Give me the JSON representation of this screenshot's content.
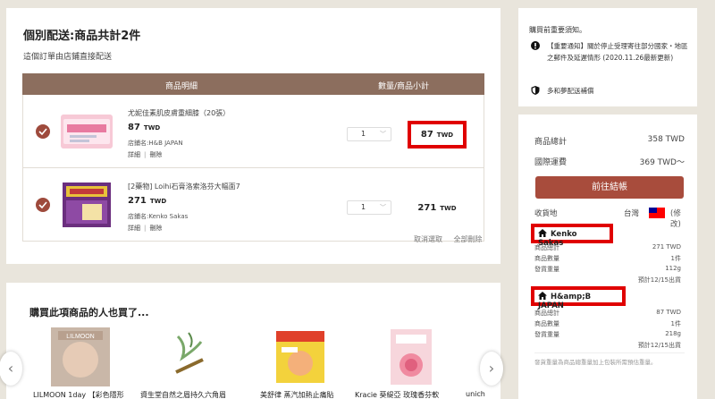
{
  "cart": {
    "title": "個別配送:商品共計2件",
    "subtitle": "這個訂單由店鋪直接配送",
    "header_item": "商品明細",
    "header_qty": "數量/商品小計",
    "items": [
      {
        "name": "尤妮佳素肌皮膚重細膝（20張）",
        "price": "87",
        "currency": "TWD",
        "store": "店鋪名:H&B JAPAN",
        "detail_link": "詳細",
        "delete_link": "刪除",
        "qty": "1",
        "subtotal": "87",
        "subtotal_currency": "TWD"
      },
      {
        "name": "[2藥物] Loihi石膏洛索洛芬大幅面7",
        "price": "271",
        "currency": "TWD",
        "store": "店鋪名:Kenko Sakas",
        "detail_link": "詳細",
        "delete_link": "刪除",
        "qty": "1",
        "subtotal": "271",
        "subtotal_currency": "TWD"
      }
    ],
    "cancel_select": "取消選取",
    "delete_all": "全部刪除"
  },
  "recommend": {
    "title": "購買此項商品的人也買了...",
    "items": [
      {
        "name": "LILMOON 1day 【彩色隱形",
        "image_label": "LILMOON"
      },
      {
        "name": "資生堂自然之眉持久六角眉"
      },
      {
        "name": "美舒律 蒸汽加熱止痛貼"
      },
      {
        "name": "Kracie 葵緹亞 玫瑰香芬軟"
      },
      {
        "name": "unich"
      }
    ]
  },
  "notice": {
    "title": "購買前重要須知。",
    "item1": "【重要通知】關於停止受理寄往部分國家・地區之郵件及延遲情形 (2020.11.26最新更新)",
    "item2": "多和夢配送補償"
  },
  "summary": {
    "total_label": "商品總計",
    "total_value": "358 TWD",
    "shipping_label": "國際運費",
    "shipping_value": "369 TWD～",
    "checkout": "前往結帳",
    "dest_label": "收貨地",
    "dest_country": "台灣",
    "change": "(修改)",
    "stores": [
      {
        "name": "Kenko Sakas",
        "l1": "商品總計",
        "v1": "271 TWD",
        "l2": "商品數量",
        "v2": "1件",
        "l3": "發貨重量",
        "v3": "112g",
        "eta": "預計12/15出貨"
      },
      {
        "name": "H&amp;B JAPAN",
        "l1": "商品總計",
        "v1": "87 TWD",
        "l2": "商品數量",
        "v2": "1件",
        "l3": "發貨重量",
        "v3": "218g",
        "eta": "預計12/15出貨"
      }
    ],
    "footnote": "發貨重量為商品總重量加上包裝所需預估重量。"
  },
  "colors": {
    "accent": "#a84c3c",
    "table_header": "#8c6e5e",
    "highlight_box": "#e00000",
    "background": "#e9e5dc"
  }
}
